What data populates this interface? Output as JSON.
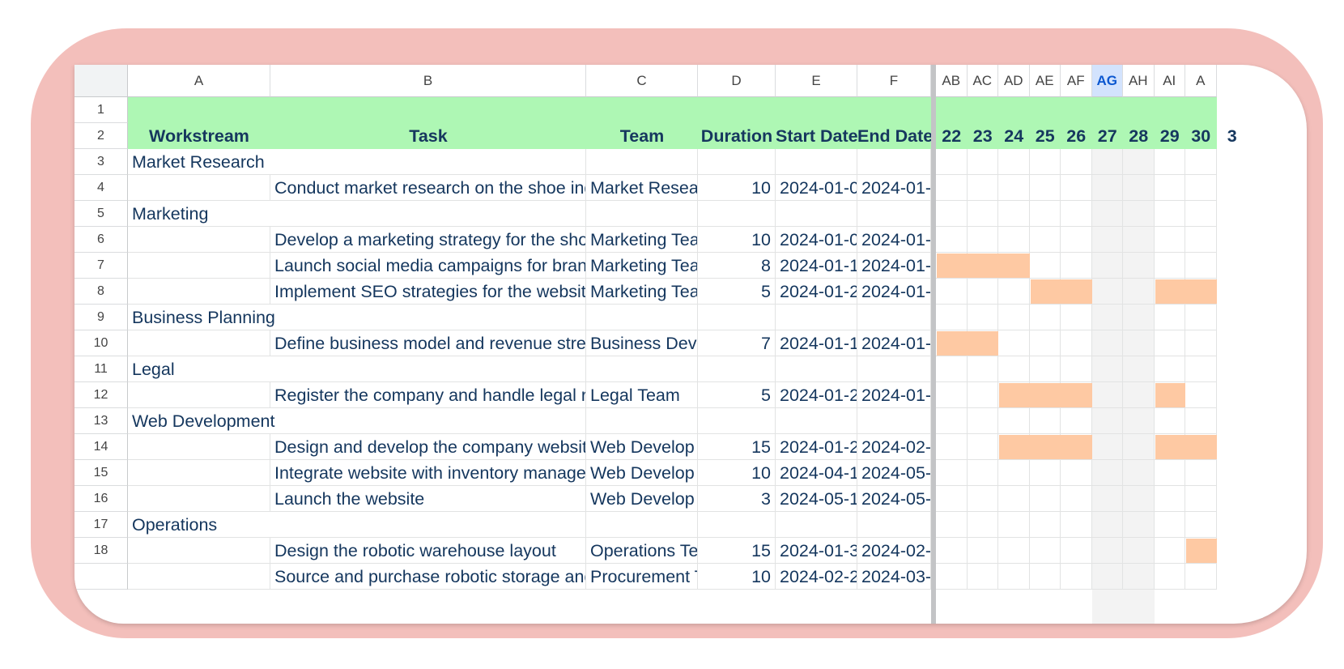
{
  "columns": {
    "main": [
      "A",
      "B",
      "C",
      "D",
      "E",
      "F"
    ],
    "timeline": [
      "AB",
      "AC",
      "AD",
      "AE",
      "AF",
      "AG",
      "AH",
      "AI",
      "A"
    ],
    "selected": "AG"
  },
  "header": {
    "workstream": "Workstream",
    "task": "Task",
    "team": "Team",
    "duration": "Duration",
    "start": "Start Date",
    "end": "End Date",
    "days": [
      "22",
      "23",
      "24",
      "25",
      "26",
      "27",
      "28",
      "29",
      "30",
      "3"
    ]
  },
  "rows": [
    {
      "n": "1"
    },
    {
      "n": "2"
    },
    {
      "n": "3",
      "a": "Market Research"
    },
    {
      "n": "4",
      "b": "Conduct market research on the shoe ind",
      "c": "Market Resea",
      "d": "10",
      "e": "2024-01-0",
      "f": "2024-01-"
    },
    {
      "n": "5",
      "a": "Marketing"
    },
    {
      "n": "6",
      "b": "Develop a marketing strategy for the sho",
      "c": "Marketing Tea",
      "d": "10",
      "e": "2024-01-0",
      "f": "2024-01-"
    },
    {
      "n": "7",
      "b": "Launch social media campaigns for brand",
      "c": "Marketing Tea",
      "d": "8",
      "e": "2024-01-1",
      "f": "2024-01-"
    },
    {
      "n": "8",
      "b": "Implement SEO strategies for the website",
      "c": "Marketing Tea",
      "d": "5",
      "e": "2024-01-2",
      "f": "2024-01-"
    },
    {
      "n": "9",
      "a": "Business Planning"
    },
    {
      "n": "10",
      "b": "Define business model and revenue strea",
      "c": "Business Deve",
      "d": "7",
      "e": "2024-01-1",
      "f": "2024-01-"
    },
    {
      "n": "11",
      "a": "Legal"
    },
    {
      "n": "12",
      "b": "Register the company and handle legal re",
      "c": "Legal Team",
      "d": "5",
      "e": "2024-01-2",
      "f": "2024-01-"
    },
    {
      "n": "13",
      "a": "Web Development"
    },
    {
      "n": "14",
      "b": "Design and develop the company website",
      "c": "Web Develop",
      "d": "15",
      "e": "2024-01-2",
      "f": "2024-02-"
    },
    {
      "n": "15",
      "b": "Integrate website with inventory manage",
      "c": "Web Develop",
      "d": "10",
      "e": "2024-04-1",
      "f": "2024-05-"
    },
    {
      "n": "16",
      "b": "Launch the website",
      "c": "Web Develop",
      "d": "3",
      "e": "2024-05-1",
      "f": "2024-05-"
    },
    {
      "n": "17",
      "a": "Operations"
    },
    {
      "n": "18",
      "b": "Design the robotic warehouse layout",
      "c": "Operations Te",
      "d": "15",
      "e": "2024-01-3",
      "f": "2024-02-"
    },
    {
      "n": "",
      "b": "Source and purchase robotic storage and",
      "c": "Procurement T",
      "d": "10",
      "e": "2024-02-2",
      "f": "2024-03-"
    }
  ],
  "gantt_bars": [
    {
      "row": "7",
      "from": "AB",
      "to": "AD"
    },
    {
      "row": "8",
      "from": "AE",
      "to": "AF"
    },
    {
      "row": "8",
      "from": "AI",
      "to": "A"
    },
    {
      "row": "10",
      "from": "AB",
      "to": "AC"
    },
    {
      "row": "12",
      "from": "AD",
      "to": "AF"
    },
    {
      "row": "12",
      "from": "AI",
      "to": "AI"
    },
    {
      "row": "14",
      "from": "AD",
      "to": "AF"
    },
    {
      "row": "14",
      "from": "AI",
      "to": "A"
    },
    {
      "row": "18",
      "from": "A",
      "to": "A"
    }
  ],
  "weekend_columns": [
    "AG",
    "AH"
  ],
  "colors": {
    "frame": "#f3bfbb",
    "header_band": "#aef7b4",
    "header_text": "#16375e",
    "cell_text": "#14365d",
    "bar": "#fec9a3",
    "weekend": "#f3f3f3",
    "selected_col": "#d3e3fd"
  }
}
